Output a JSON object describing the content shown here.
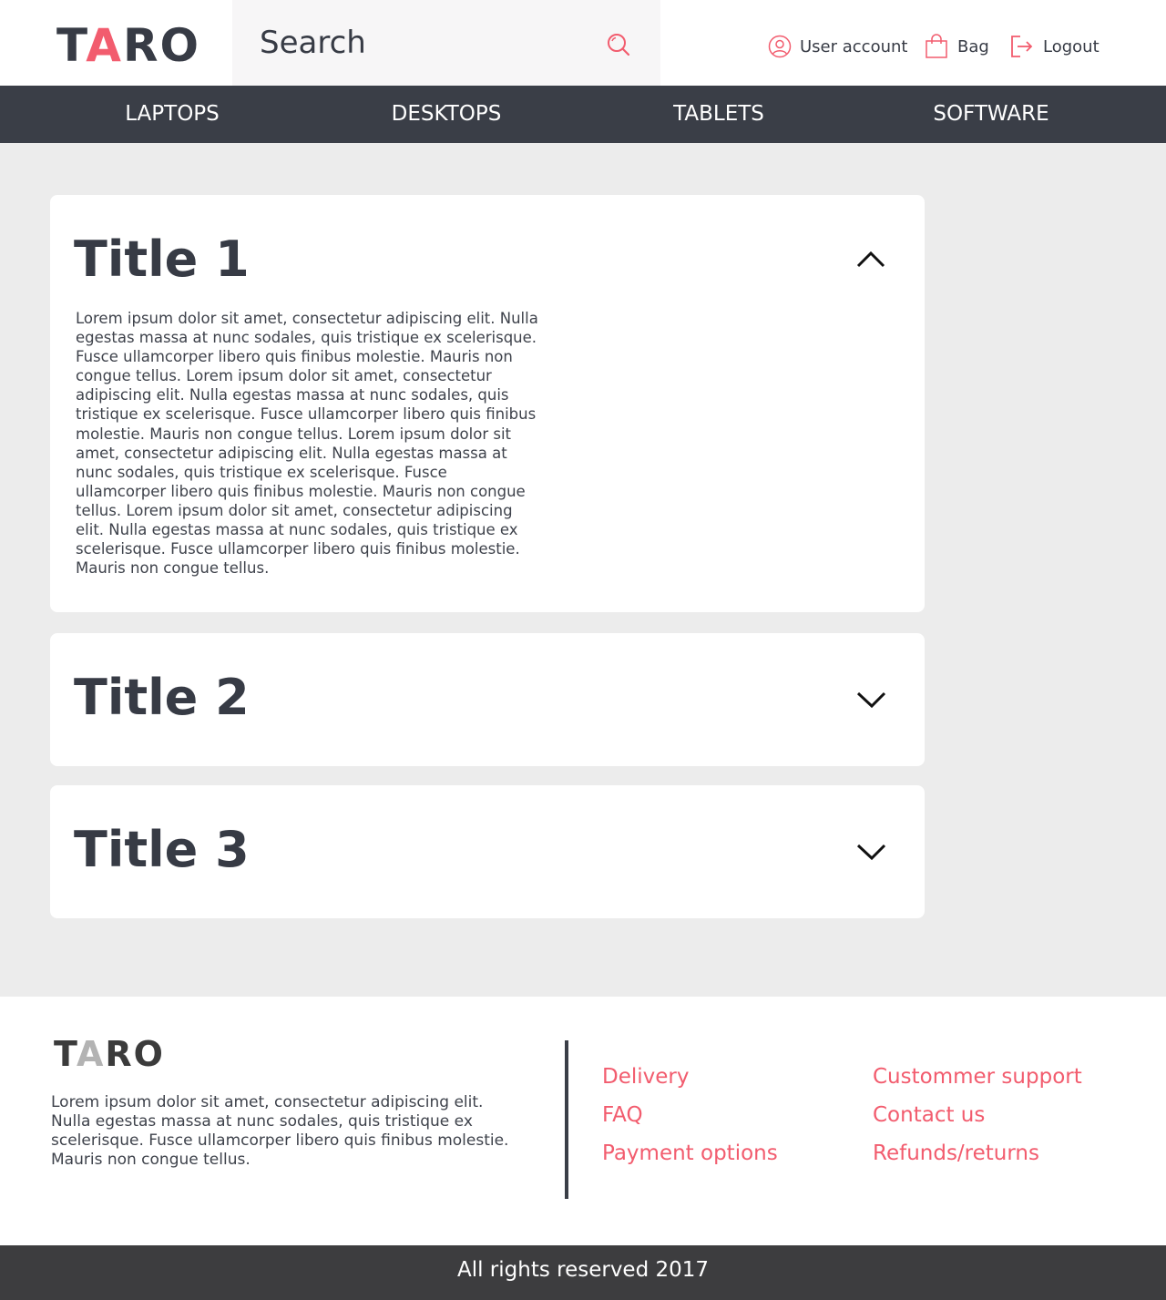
{
  "header": {
    "logo_part1": "T",
    "logo_accent": "A",
    "logo_part2": "RO",
    "search_placeholder": "Search",
    "user_account_label": "User account",
    "bag_label": "Bag",
    "logout_label": "Logout"
  },
  "categories": [
    "LAPTOPS",
    "DESKTOPS",
    "TABLETS",
    "SOFTWARE"
  ],
  "accordion": [
    {
      "title": "Title 1",
      "expanded": true,
      "body": "Lorem ipsum dolor sit amet, consectetur adipiscing elit. Nulla egestas massa at nunc sodales, quis tristique ex scelerisque. Fusce ullamcorper libero quis finibus molestie. Mauris non congue tellus. Lorem ipsum dolor sit amet, consectetur adipiscing elit. Nulla egestas massa at nunc sodales, quis tristique ex scelerisque. Fusce ullamcorper libero quis finibus molestie. Mauris non congue tellus. Lorem ipsum dolor sit amet, consectetur adipiscing elit. Nulla egestas massa at nunc sodales, quis tristique ex scelerisque. Fusce ullamcorper libero quis finibus molestie. Mauris non congue tellus. Lorem ipsum dolor sit amet, consectetur adipiscing elit. Nulla egestas massa at nunc sodales, quis tristique ex scelerisque. Fusce ullamcorper libero quis finibus molestie. Mauris non congue tellus."
    },
    {
      "title": "Title 2",
      "expanded": false
    },
    {
      "title": "Title 3",
      "expanded": false
    }
  ],
  "footer": {
    "logo_part1": "T",
    "logo_accent": "A",
    "logo_part2": "RO",
    "description": "Lorem ipsum dolor sit amet, consectetur adipiscing elit. Nulla egestas massa at nunc sodales, quis tristique ex scelerisque. Fusce ullamcorper libero quis finibus molestie. Mauris non congue tellus.",
    "links_col1": [
      "Delivery",
      "FAQ",
      "Payment options"
    ],
    "links_col2": [
      "Custommer support",
      "Contact us",
      "Refunds/returns"
    ],
    "copyright": "All rights reserved 2017"
  },
  "colors": {
    "accent": "#f25c6e",
    "dark": "#373b45",
    "navbar": "#3a3e47",
    "background": "#ececec"
  }
}
